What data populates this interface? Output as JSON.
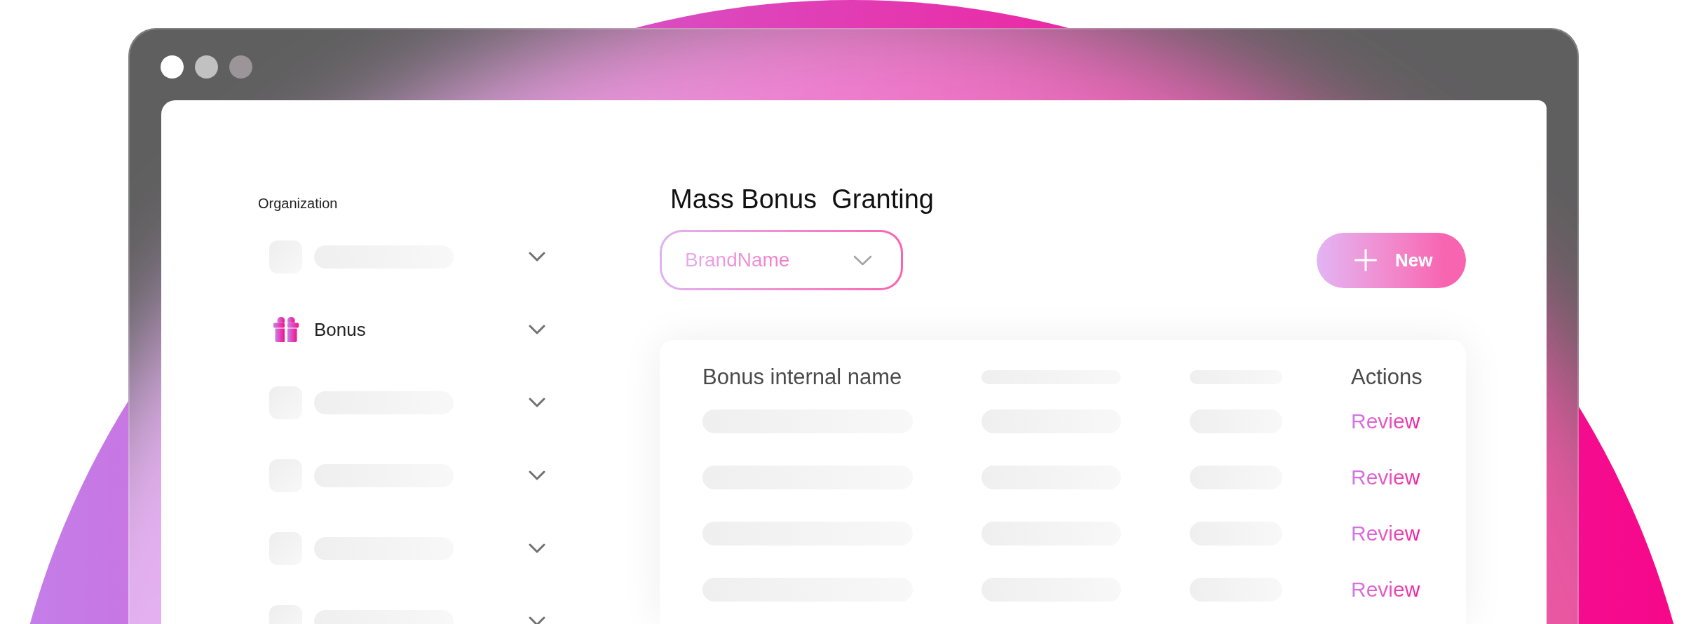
{
  "sidebar": {
    "heading": "Organization",
    "items": [
      {
        "kind": "skeleton"
      },
      {
        "kind": "item",
        "label": "Bonus"
      },
      {
        "kind": "skeleton"
      },
      {
        "kind": "skeleton"
      },
      {
        "kind": "skeleton"
      },
      {
        "kind": "skeleton"
      }
    ]
  },
  "header": {
    "title": "Mass Bonus  Granting",
    "brand_dropdown": {
      "value": "BrandName"
    },
    "new_button": {
      "label": "New"
    }
  },
  "table": {
    "columns": [
      {
        "kind": "text",
        "label": "Bonus internal name"
      },
      {
        "kind": "skeleton"
      },
      {
        "kind": "skeleton"
      },
      {
        "kind": "text",
        "label": "Actions"
      }
    ],
    "rows": [
      {
        "cells": [
          {
            "kind": "skeleton"
          },
          {
            "kind": "skeleton"
          },
          {
            "kind": "skeleton"
          },
          {
            "kind": "link",
            "text": "Review"
          }
        ]
      },
      {
        "cells": [
          {
            "kind": "skeleton"
          },
          {
            "kind": "skeleton"
          },
          {
            "kind": "skeleton"
          },
          {
            "kind": "link",
            "text": "Review"
          }
        ]
      },
      {
        "cells": [
          {
            "kind": "skeleton"
          },
          {
            "kind": "skeleton"
          },
          {
            "kind": "skeleton"
          },
          {
            "kind": "link",
            "text": "Review"
          }
        ]
      },
      {
        "cells": [
          {
            "kind": "skeleton"
          },
          {
            "kind": "skeleton"
          },
          {
            "kind": "skeleton"
          },
          {
            "kind": "link",
            "text": "Review"
          }
        ]
      }
    ]
  }
}
